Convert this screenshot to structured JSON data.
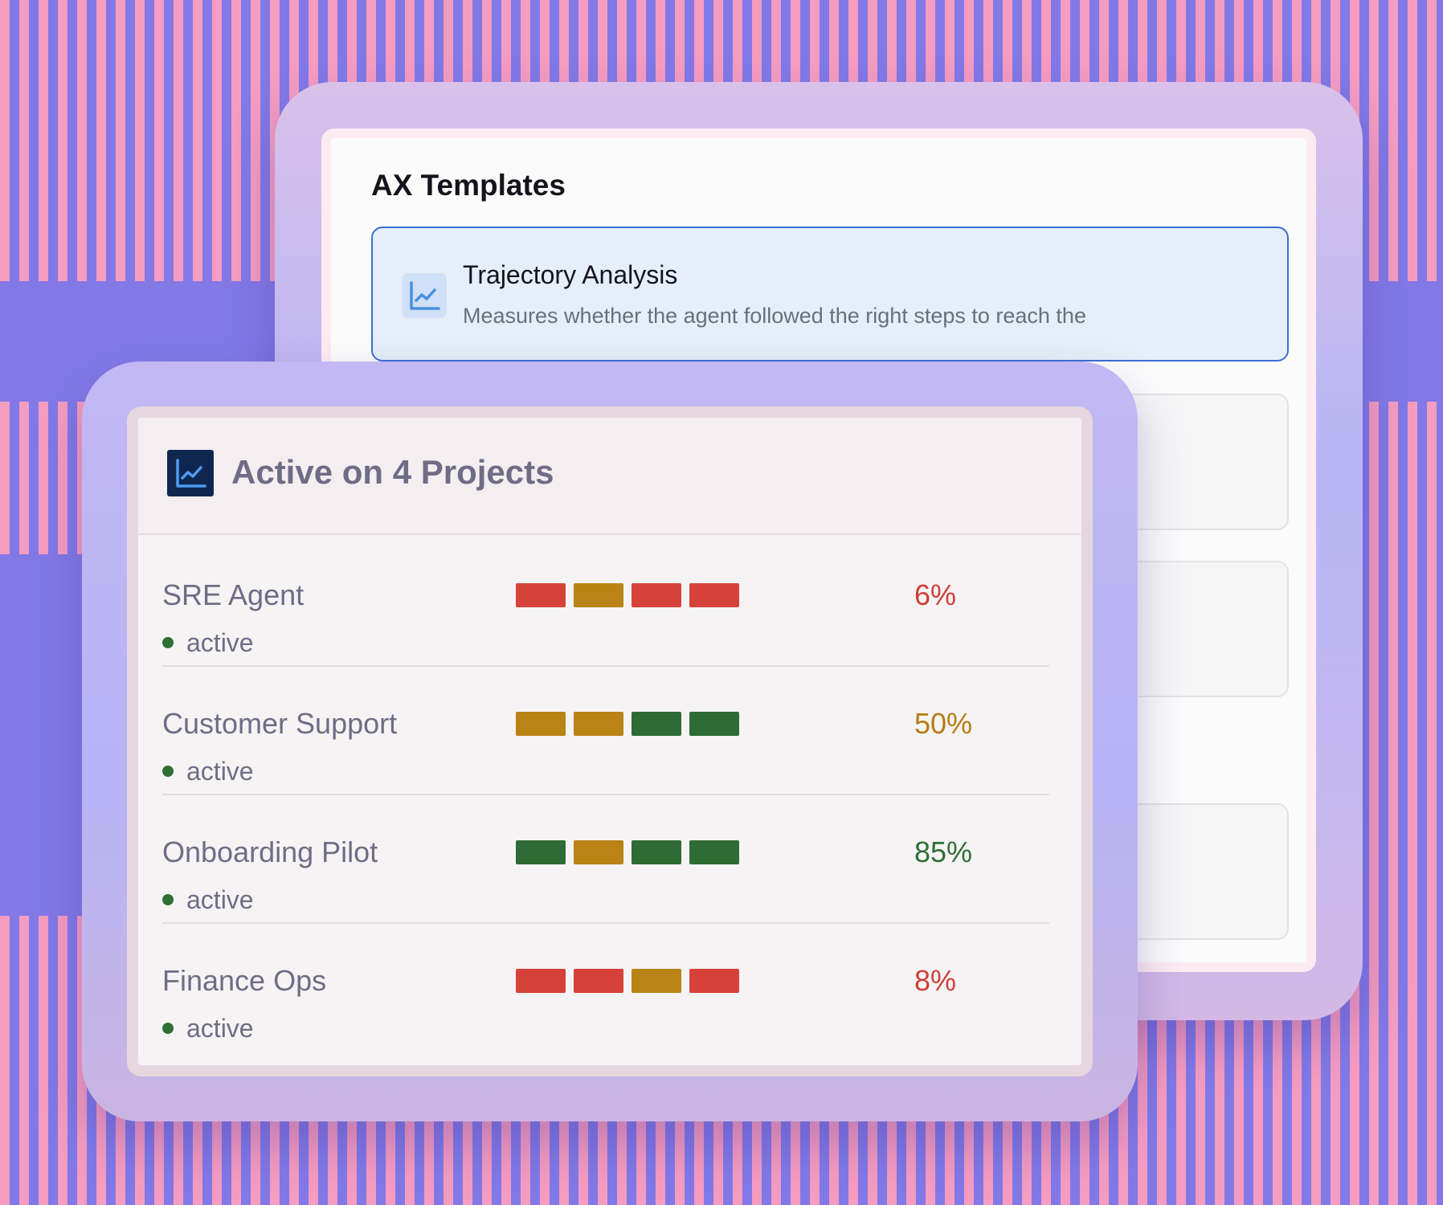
{
  "templates": {
    "title": "AX Templates",
    "selected_card": {
      "name": "Trajectory Analysis",
      "description": "Measures whether the agent followed the right steps to reach the",
      "icon": "line-chart-icon"
    }
  },
  "projects": {
    "title": "Active on 4 Projects",
    "icon": "line-chart-icon",
    "rows": [
      {
        "name": "SRE Agent",
        "status": "active",
        "percent": "6%",
        "percent_color": "#cf3f37",
        "segments": [
          "red",
          "amber",
          "red",
          "red"
        ]
      },
      {
        "name": "Customer Support",
        "status": "active",
        "percent": "50%",
        "percent_color": "#b57d12",
        "segments": [
          "amber",
          "amber",
          "green",
          "green"
        ]
      },
      {
        "name": "Onboarding Pilot",
        "status": "active",
        "percent": "85%",
        "percent_color": "#2f6f36",
        "segments": [
          "green",
          "amber",
          "green",
          "green"
        ]
      },
      {
        "name": "Finance Ops",
        "status": "active",
        "percent": "8%",
        "percent_color": "#cf3f37",
        "segments": [
          "red",
          "red",
          "amber",
          "red"
        ]
      }
    ]
  },
  "colors": {
    "red": "#d6423a",
    "amber": "#b98315",
    "green": "#2f6b35",
    "status_dot": "#2f6f36",
    "card_border": "#3a6fd1",
    "background_pink": "#f59cc1",
    "background_purple": "#8279e6"
  }
}
